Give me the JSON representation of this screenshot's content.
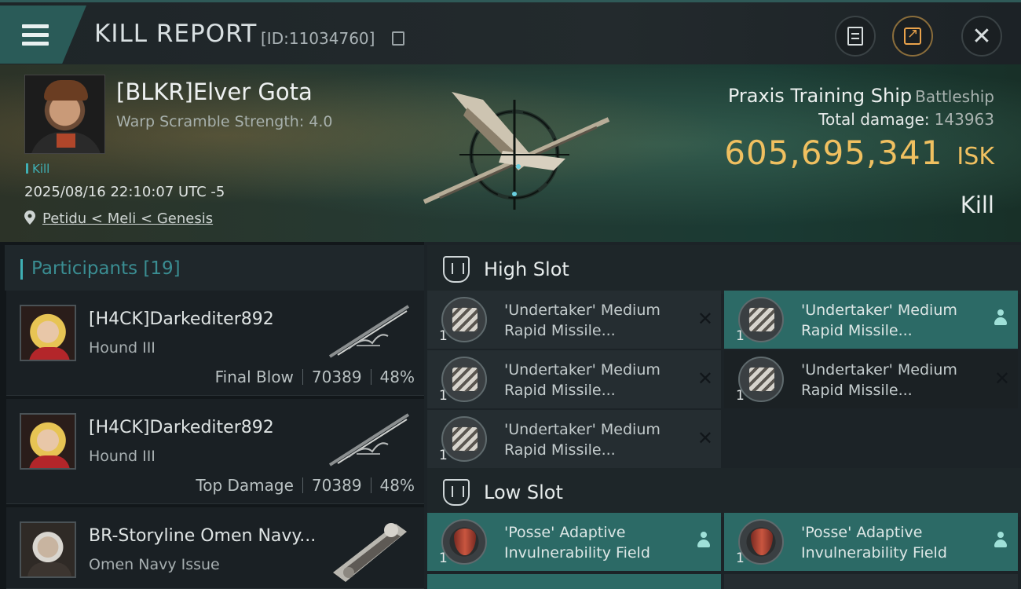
{
  "topbar": {
    "title": "KILL REPORT",
    "report_id": "[ID:11034760]",
    "icons": {
      "menu": "hamburger-menu-icon",
      "copy": "copy-icon",
      "notes": "notes-icon",
      "share": "share-icon",
      "close": "close-icon"
    }
  },
  "victim": {
    "name": "[BLKR]Elver Gota",
    "warp": "Warp Scramble Strength: 4.0",
    "tag": "Kill",
    "datetime": "2025/08/16 22:10:07 UTC -5",
    "location": "Petidu < Meli < Genesis"
  },
  "ship": {
    "name": "Praxis Training Ship",
    "class": "Battleship",
    "total_damage_label": "Total damage:",
    "total_damage": "143963",
    "isk_amount": "605,695,341",
    "isk_unit": "ISK",
    "result": "Kill"
  },
  "participants": {
    "title": "Participants [19]",
    "rows": [
      {
        "name": "[H4CK]Darkediter892",
        "ship": "Hound III",
        "label": "Final Blow",
        "damage": "70389",
        "percent": "48%"
      },
      {
        "name": "[H4CK]Darkediter892",
        "ship": "Hound III",
        "label": "Top Damage",
        "damage": "70389",
        "percent": "48%"
      },
      {
        "name": "BR-Storyline Omen Navy...",
        "ship": "Omen Navy Issue",
        "label": "",
        "damage": "",
        "percent": ""
      }
    ]
  },
  "high_slot": {
    "title": "High Slot",
    "modules": [
      {
        "name": "'Undertaker' Medium Rapid Missile...",
        "qty": "1"
      },
      {
        "name": "'Undertaker' Medium Rapid Missile...",
        "qty": "1"
      },
      {
        "name": "'Undertaker' Medium Rapid Missile...",
        "qty": "1"
      },
      {
        "name": "'Undertaker' Medium Rapid Missile...",
        "qty": "1"
      },
      {
        "name": "'Undertaker' Medium Rapid Missile...",
        "qty": "1"
      }
    ]
  },
  "low_slot": {
    "title": "Low Slot",
    "modules": [
      {
        "name": "'Posse' Adaptive Invulnerability Field",
        "qty": "1"
      },
      {
        "name": "'Posse' Adaptive Invulnerability Field",
        "qty": "1"
      }
    ]
  },
  "colors": {
    "accent": "#3fb0b5",
    "isk": "#f0c060",
    "fitted": "#2c6a66"
  }
}
